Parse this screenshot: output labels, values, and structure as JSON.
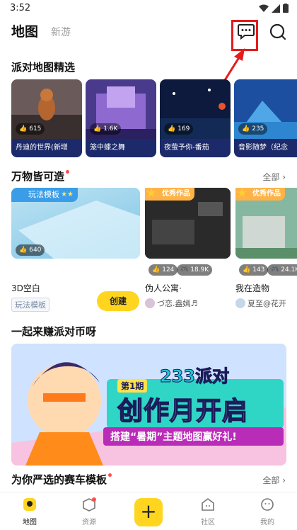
{
  "status": {
    "time": "3:52"
  },
  "header": {
    "active_tab": "地图",
    "inactive_tab": "新游"
  },
  "sections": {
    "featured": "派对地图精选",
    "all_things": "万物皆可造",
    "earn": "一起来赚派对币呀",
    "racing": "为你严选的赛车模板",
    "all_label": "全部"
  },
  "featured_maps": [
    {
      "name": "丹迪的世界(新增",
      "likes": "615"
    },
    {
      "name": "笼中蝶之舞",
      "likes": "1.6K"
    },
    {
      "name": "夜萤予你-番茄",
      "likes": "169"
    },
    {
      "name": "音影随梦（纪念",
      "likes": "235"
    }
  ],
  "items": [
    {
      "badge": "玩法模板",
      "name": "3D空白",
      "likes": "640",
      "tag": "玩法模板",
      "button": "创建"
    },
    {
      "badge": "优秀作品",
      "name": "伪人公寓·",
      "likes": "124",
      "plays": "18.9K",
      "author": "づ恋.盎嫣♬"
    },
    {
      "badge": "优秀作品",
      "name": "我在造物",
      "likes": "143",
      "plays": "24.1K",
      "author": "夏至@花开"
    }
  ],
  "banner": {
    "issue": "第1期",
    "title_top": "233派对",
    "title_main": "创作月开启",
    "subtitle": "搭建“暑期”主题地图赢好礼!"
  },
  "nav": {
    "map": "地图",
    "resource": "资源",
    "plus": "+",
    "community": "社区",
    "mine": "我的"
  },
  "colors": {
    "accent": "#ffd51f",
    "highlight": "#e41c1c"
  }
}
